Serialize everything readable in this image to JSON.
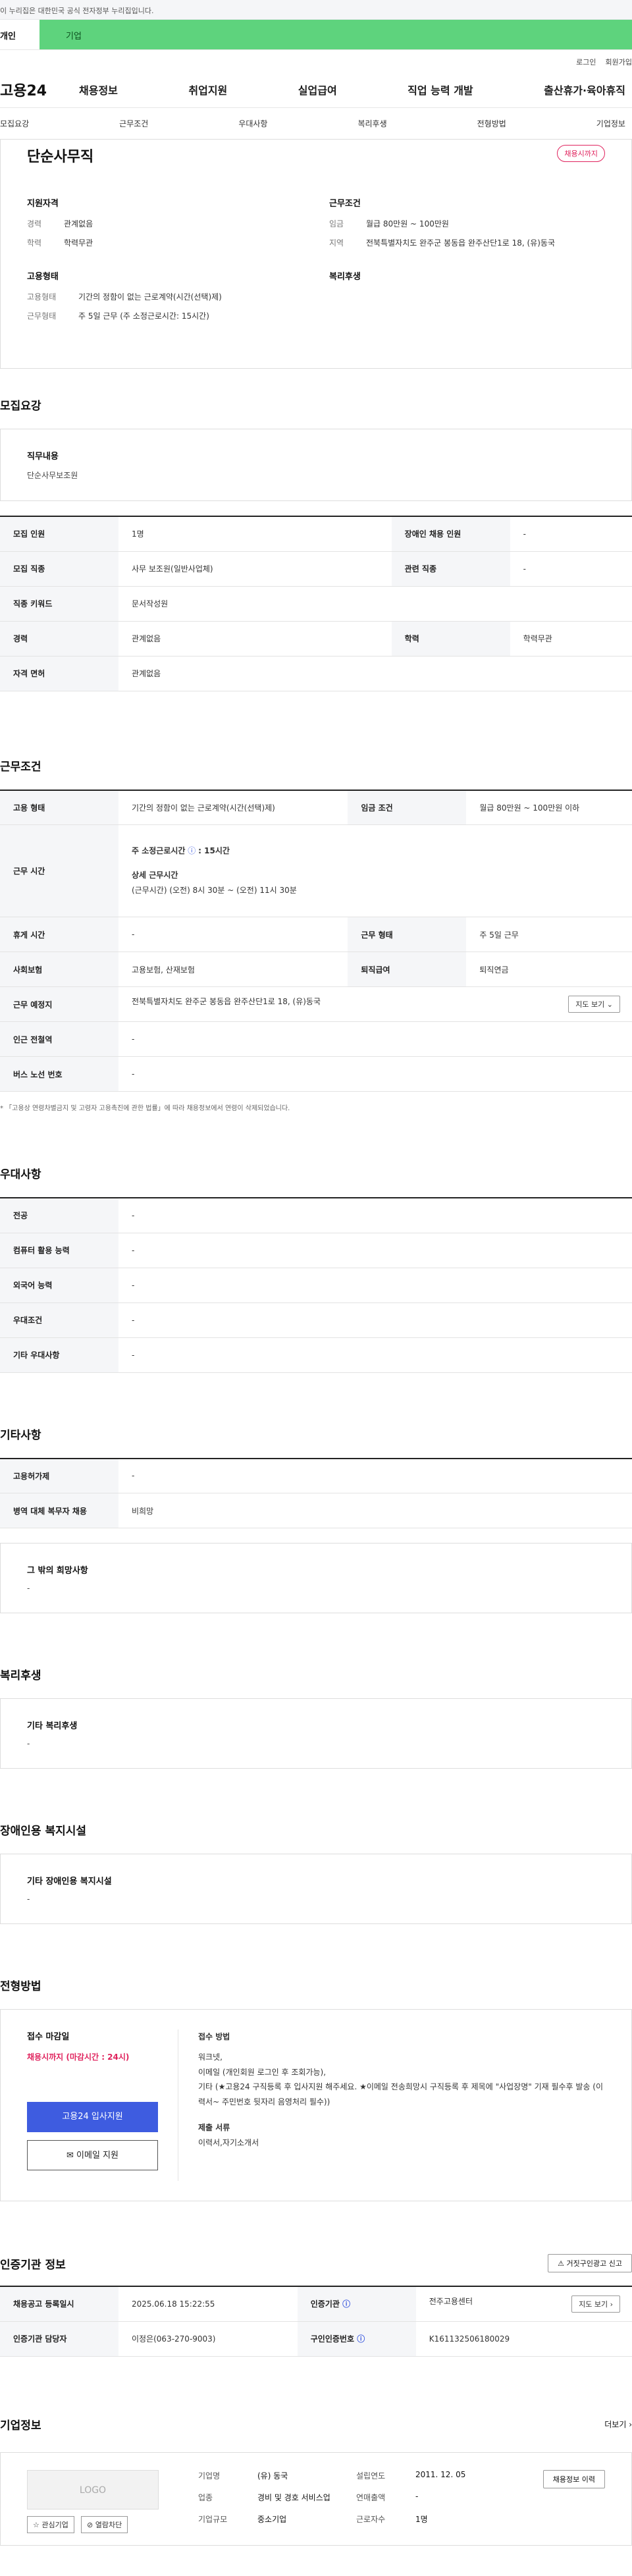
{
  "gov_notice": "이 누리집은 대한민국 공식 전자정부 누리집입니다.",
  "top_tabs": [
    "개인",
    "기업"
  ],
  "util": [
    "로그인",
    "회원가입"
  ],
  "logo": "고용24",
  "gnb": [
    "채용정보",
    "취업지원",
    "실업급여",
    "직업 능력 개발",
    "출산휴가·육아휴직"
  ],
  "snb": [
    "모집요강",
    "근무조건",
    "우대사항",
    "복리후생",
    "전형방법",
    "기업정보"
  ],
  "job": {
    "title": "단순사무직",
    "badge": "채용시까지",
    "qual_h": "지원자격",
    "qual": [
      {
        "k": "경력",
        "v": "관계없음"
      },
      {
        "k": "학력",
        "v": "학력무관"
      }
    ],
    "cond_h": "근무조건",
    "cond": [
      {
        "k": "임금",
        "v": "월급 80만원 ~ 100만원"
      },
      {
        "k": "지역",
        "v": "전북특별자치도 완주군 봉동읍 완주산단1로 18, (유)동국"
      }
    ],
    "emp_h": "고용형태",
    "emp": [
      {
        "k": "고용형태",
        "v": "기간의 정함이 없는 근로계약(시간(선택)제)"
      },
      {
        "k": "근무형태",
        "v": "주 5일 근무 (주 소정근로시간: 15시간)"
      }
    ],
    "welfare_h": "복리후생"
  },
  "recruit": {
    "h": "모집요강",
    "duty_t": "직무내용",
    "duty_v": "단순사무보조원",
    "rows": [
      [
        "모집 인원",
        "1명",
        "장애인 채용 인원",
        "-"
      ],
      [
        "모집 직종",
        "사무 보조원(일반사업체)",
        "관련 직종",
        "-"
      ],
      [
        "직종 키워드",
        "문서작성원",
        "",
        ""
      ],
      [
        "경력",
        "관계없음",
        "학력",
        "학력무관"
      ],
      [
        "자격 면허",
        "관계없음",
        "",
        ""
      ]
    ]
  },
  "work": {
    "h": "근무조건",
    "emp_k": "고용 형태",
    "emp_v": "기간의 정함이 없는 근로계약(시간(선택)제)",
    "wage_k": "임금 조건",
    "wage_v": "월급 80만원 ~ 100만원 이하",
    "time_k": "근무 시간",
    "time_1": "주 소정근로시간",
    "time_1v": ": 15시간",
    "time_2": "상세 근무시간",
    "time_3": "(근무시간) (오전) 8시 30분 ~ (오전) 11시 30분",
    "rest_k": "휴게 시간",
    "rest_v": "-",
    "form_k": "근무 형태",
    "form_v": "주 5일 근무",
    "ins_k": "사회보험",
    "ins_v": "고용보험, 산재보험",
    "ret_k": "퇴직급여",
    "ret_v": "퇴직연금",
    "place_k": "근무 예정지",
    "place_v": "전북특별자치도 완주군 봉동읍 완주산단1로 18, (유)동국",
    "map": "지도 보기",
    "sub_k": "인근 전철역",
    "sub_v": "-",
    "bus_k": "버스 노선 번호",
    "bus_v": "-",
    "note": "* 「고용상 연령차별금지 및 고령자 고용촉진에 관한 법률」에 따라 채용정보에서 연령이 삭제되었습니다."
  },
  "pref": {
    "h": "우대사항",
    "rows": [
      [
        "전공",
        "-"
      ],
      [
        "컴퓨터 활용 능력",
        "-"
      ],
      [
        "외국어 능력",
        "-"
      ],
      [
        "우대조건",
        "-"
      ],
      [
        "기타 우대사항",
        "-"
      ]
    ]
  },
  "etc": {
    "h": "기타사항",
    "rows": [
      [
        "고용허가제",
        "-"
      ],
      [
        "병역 대체 복무자 채용",
        "비희망"
      ]
    ],
    "box_t": "그 밖의 희망사항",
    "box_v": "-"
  },
  "welfare": {
    "h": "복리후생",
    "t": "기타 복리후생",
    "v": "-"
  },
  "disab": {
    "h": "장애인용 복지시설",
    "t": "기타 장애인용 복지시설",
    "v": "-"
  },
  "process": {
    "h": "전형방법",
    "deadline_t": "접수 마감일",
    "deadline_v": "채용시까지 (마감시간 : 24시)",
    "apply": "고용24 입사지원",
    "email": "이메일 지원",
    "method_t": "접수 방법",
    "method_1": "워크넷,",
    "method_2": "이메일 (개인회원 로그인 후 조회가능),",
    "method_3": "기타 (★고용24 구직등록 후  입사지원 해주세요.  ★이메일 전송희망시 구직등록 후 제목에 \"사업장명\" 기재 필수후 발송 (이력서~ 주민번호 뒷자리 음영처리 필수))",
    "docs_t": "제출 서류",
    "docs_v": "이력서,자기소개서"
  },
  "cert": {
    "h": "인증기관 정보",
    "report": "거짓구인광고 신고",
    "reg_k": "채용공고 등록일시",
    "reg_v": "2025.06.18 15:22:55",
    "org_k": "인증기관",
    "org_v": "전주고용센터",
    "map": "지도 보기",
    "mgr_k": "인증기관 담당자",
    "mgr_v": "이정은(063-270-9003)",
    "no_k": "구인인증번호",
    "no_v": "K161132506180029"
  },
  "company": {
    "h": "기업정보",
    "more": "더보기",
    "logo": "LOGO",
    "fav": "관심기업",
    "block": "열람차단",
    "name_k": "기업명",
    "name_v": "(유) 동국",
    "year_k": "설립연도",
    "year_v": "2011. 12. 05",
    "ind_k": "업종",
    "ind_v": "경비 및 경호 서비스업",
    "sales_k": "연매출액",
    "sales_v": "-",
    "size_k": "기업규모",
    "size_v": "중소기업",
    "emp_k": "근로자수",
    "emp_v": "1명",
    "recruit_btn": "채용정보 이력"
  }
}
